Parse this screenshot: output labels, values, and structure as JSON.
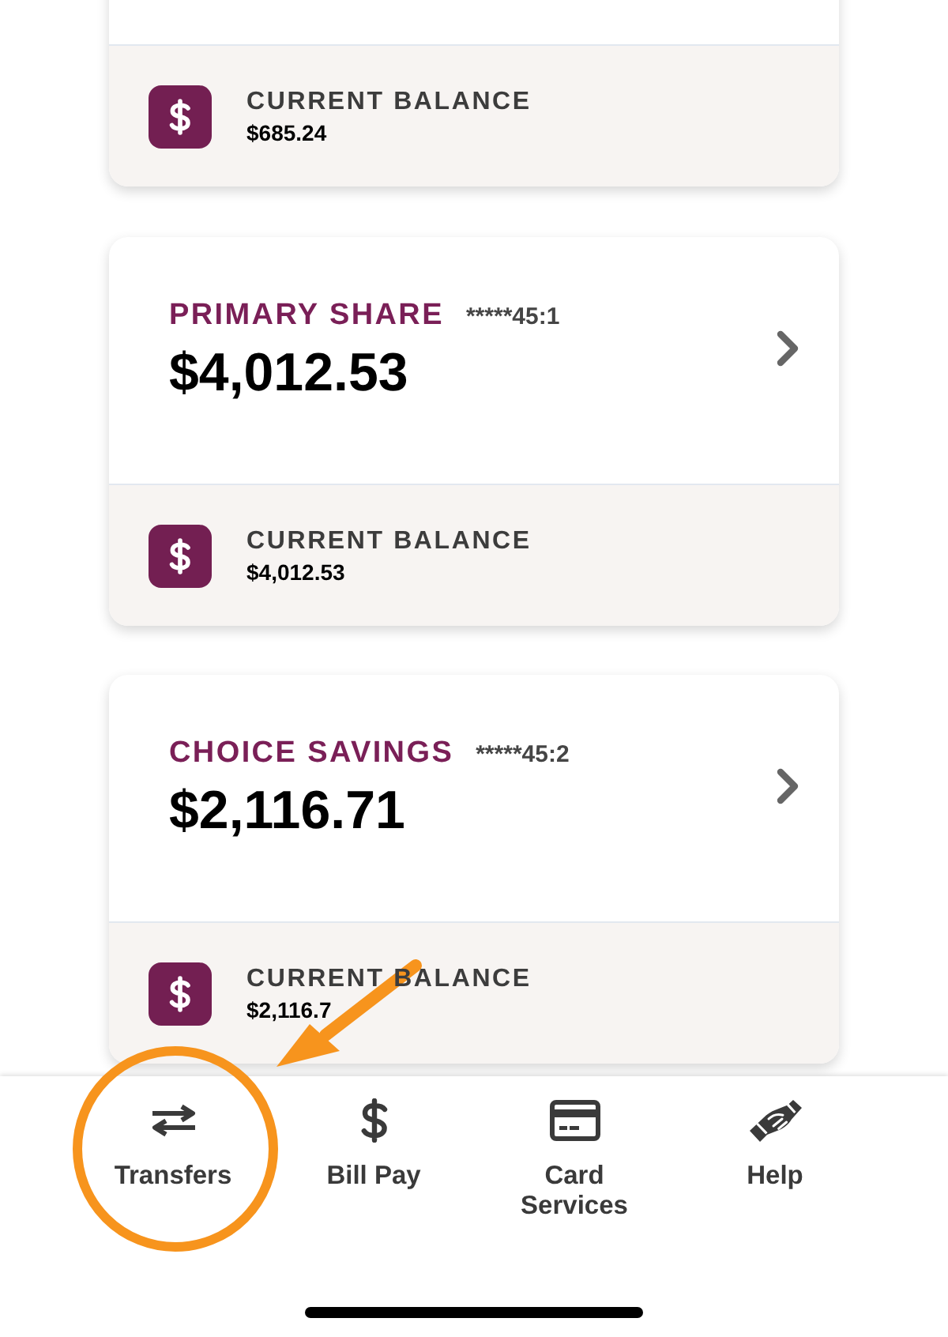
{
  "accounts": [
    {
      "balance_label": "CURRENT BALANCE",
      "balance": "$685.24"
    },
    {
      "name": "PRIMARY SHARE",
      "number": "*****45:1",
      "amount": "$4,012.53",
      "balance_label": "CURRENT BALANCE",
      "balance": "$4,012.53"
    },
    {
      "name": "CHOICE SAVINGS",
      "number": "*****45:2",
      "amount": "$2,116.71",
      "balance_label": "CURRENT BALANCE",
      "balance": "$2,116.7"
    }
  ],
  "tab_bar": {
    "items": [
      {
        "label": "Transfers",
        "kind": "transfers"
      },
      {
        "label": "Bill Pay",
        "kind": "bill_pay"
      },
      {
        "label": "Card Services",
        "kind": "card"
      },
      {
        "label": "Help",
        "kind": "help"
      }
    ]
  }
}
